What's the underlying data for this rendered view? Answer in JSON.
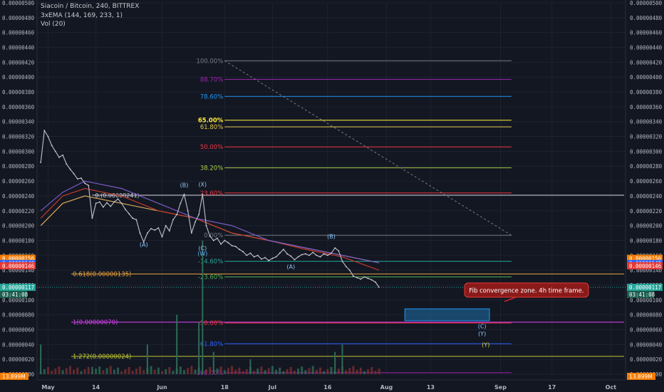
{
  "chart_data": {
    "type": "line",
    "legend": {
      "title": "Siacoin / Bitcoin, 240, BITTREX",
      "indicator_ema": "3xEMA (144, 169, 233, 1)",
      "indicator_vol": "Vol (20)"
    },
    "ylim": [
      0,
      5e-06
    ],
    "yticks": [
      "0.00000500",
      "0.00000480",
      "0.00000460",
      "0.00000440",
      "0.00000420",
      "0.00000400",
      "0.00000380",
      "0.00000360",
      "0.00000340",
      "0.00000320",
      "0.00000300",
      "0.00000280",
      "0.00000260",
      "0.00000240",
      "0.00000220",
      "0.00000200",
      "0.00000180",
      "0.00000160",
      "0.00000140",
      "0.00000120",
      "0.00000100",
      "0.00000080",
      "0.00000060",
      "0.00000040",
      "0.00000020",
      "0.00000000"
    ],
    "x_ticks": [
      {
        "label": "May",
        "x": 0
      },
      {
        "label": "14",
        "x": 13
      },
      {
        "label": "Jun",
        "x": 31
      },
      {
        "label": "18",
        "x": 48
      },
      {
        "label": "Jul",
        "x": 61
      },
      {
        "label": "16",
        "x": 76
      },
      {
        "label": "Aug",
        "x": 92
      },
      {
        "label": "13",
        "x": 104
      },
      {
        "label": "Sep",
        "x": 123
      },
      {
        "label": "17",
        "x": 137
      },
      {
        "label": "Oct",
        "x": 153
      }
    ],
    "price_series": [
      {
        "x": -2,
        "y": 2.85e-06
      },
      {
        "x": -1,
        "y": 3.28e-06
      },
      {
        "x": 0,
        "y": 3.2e-06
      },
      {
        "x": 1,
        "y": 3.08e-06
      },
      {
        "x": 2,
        "y": 3e-06
      },
      {
        "x": 3,
        "y": 2.92e-06
      },
      {
        "x": 4,
        "y": 2.95e-06
      },
      {
        "x": 5,
        "y": 2.83e-06
      },
      {
        "x": 6,
        "y": 2.76e-06
      },
      {
        "x": 7,
        "y": 2.7e-06
      },
      {
        "x": 8,
        "y": 2.63e-06
      },
      {
        "x": 9,
        "y": 2.64e-06
      },
      {
        "x": 10,
        "y": 2.57e-06
      },
      {
        "x": 11,
        "y": 2.54e-06
      },
      {
        "x": 12,
        "y": 2.1e-06
      },
      {
        "x": 13,
        "y": 2.3e-06
      },
      {
        "x": 14,
        "y": 2.32e-06
      },
      {
        "x": 15,
        "y": 2.25e-06
      },
      {
        "x": 16,
        "y": 2.31e-06
      },
      {
        "x": 17,
        "y": 2.26e-06
      },
      {
        "x": 18,
        "y": 2.32e-06
      },
      {
        "x": 19,
        "y": 2.36e-06
      },
      {
        "x": 20,
        "y": 2.3e-06
      },
      {
        "x": 21,
        "y": 2.22e-06
      },
      {
        "x": 22,
        "y": 2.16e-06
      },
      {
        "x": 23,
        "y": 2.1e-06
      },
      {
        "x": 24,
        "y": 2.08e-06
      },
      {
        "x": 25,
        "y": 1.9e-06
      },
      {
        "x": 26,
        "y": 1.78e-06
      },
      {
        "x": 27,
        "y": 1.9e-06
      },
      {
        "x": 28,
        "y": 1.96e-06
      },
      {
        "x": 29,
        "y": 1.94e-06
      },
      {
        "x": 30,
        "y": 1.97e-06
      },
      {
        "x": 31,
        "y": 1.85e-06
      },
      {
        "x": 32,
        "y": 2e-06
      },
      {
        "x": 33,
        "y": 1.93e-06
      },
      {
        "x": 34,
        "y": 2.08e-06
      },
      {
        "x": 35,
        "y": 2.15e-06
      },
      {
        "x": 36,
        "y": 2.3e-06
      },
      {
        "x": 37,
        "y": 2.42e-06
      },
      {
        "x": 38,
        "y": 2.2e-06
      },
      {
        "x": 39,
        "y": 1.9e-06
      },
      {
        "x": 40,
        "y": 2.05e-06
      },
      {
        "x": 41,
        "y": 2.15e-06
      },
      {
        "x": 42,
        "y": 2.42e-06
      },
      {
        "x": 43,
        "y": 2e-06
      },
      {
        "x": 44,
        "y": 1.86e-06
      },
      {
        "x": 45,
        "y": 1.8e-06
      },
      {
        "x": 46,
        "y": 1.83e-06
      },
      {
        "x": 47,
        "y": 1.75e-06
      },
      {
        "x": 48,
        "y": 1.8e-06
      },
      {
        "x": 49,
        "y": 1.77e-06
      },
      {
        "x": 50,
        "y": 1.73e-06
      },
      {
        "x": 51,
        "y": 1.72e-06
      },
      {
        "x": 52,
        "y": 1.68e-06
      },
      {
        "x": 53,
        "y": 1.65e-06
      },
      {
        "x": 54,
        "y": 1.6e-06
      },
      {
        "x": 55,
        "y": 1.63e-06
      },
      {
        "x": 56,
        "y": 1.58e-06
      },
      {
        "x": 57,
        "y": 1.6e-06
      },
      {
        "x": 58,
        "y": 1.55e-06
      },
      {
        "x": 59,
        "y": 1.57e-06
      },
      {
        "x": 60,
        "y": 1.53e-06
      },
      {
        "x": 61,
        "y": 1.56e-06
      },
      {
        "x": 62,
        "y": 1.58e-06
      },
      {
        "x": 63,
        "y": 1.63e-06
      },
      {
        "x": 64,
        "y": 1.68e-06
      },
      {
        "x": 65,
        "y": 1.62e-06
      },
      {
        "x": 66,
        "y": 1.59e-06
      },
      {
        "x": 67,
        "y": 1.54e-06
      },
      {
        "x": 68,
        "y": 1.58e-06
      },
      {
        "x": 69,
        "y": 1.61e-06
      },
      {
        "x": 70,
        "y": 1.62e-06
      },
      {
        "x": 71,
        "y": 1.6e-06
      },
      {
        "x": 72,
        "y": 1.64e-06
      },
      {
        "x": 73,
        "y": 1.6e-06
      },
      {
        "x": 74,
        "y": 1.58e-06
      },
      {
        "x": 75,
        "y": 1.62e-06
      },
      {
        "x": 76,
        "y": 1.6e-06
      },
      {
        "x": 77,
        "y": 1.63e-06
      },
      {
        "x": 78,
        "y": 1.7e-06
      },
      {
        "x": 79,
        "y": 1.66e-06
      },
      {
        "x": 80,
        "y": 1.52e-06
      },
      {
        "x": 81,
        "y": 1.45e-06
      },
      {
        "x": 82,
        "y": 1.4e-06
      },
      {
        "x": 83,
        "y": 1.32e-06
      },
      {
        "x": 84,
        "y": 1.3e-06
      },
      {
        "x": 85,
        "y": 1.28e-06
      },
      {
        "x": 86,
        "y": 1.31e-06
      },
      {
        "x": 87,
        "y": 1.29e-06
      },
      {
        "x": 88,
        "y": 1.27e-06
      },
      {
        "x": 89,
        "y": 1.24e-06
      },
      {
        "x": 90,
        "y": 1.17e-06
      }
    ],
    "volume_spikes": [
      {
        "x": -2,
        "v": 4e-07
      },
      {
        "x": 12,
        "v": 1e-07
      },
      {
        "x": 27,
        "v": 4e-07
      },
      {
        "x": 35,
        "v": 8e-07
      },
      {
        "x": 41,
        "v": 7e-07
      },
      {
        "x": 42,
        "v": 1.8e-06
      },
      {
        "x": 45,
        "v": 3e-07
      },
      {
        "x": 55,
        "v": 2e-07
      },
      {
        "x": 78,
        "v": 3e-07
      },
      {
        "x": 80,
        "v": 4e-07
      }
    ],
    "ema_series": [
      {
        "name": "EMA 144",
        "color": "#d7a85a",
        "points": [
          {
            "x": -2,
            "y": 2e-06
          },
          {
            "x": 4,
            "y": 2.3e-06
          },
          {
            "x": 10,
            "y": 2.4e-06
          },
          {
            "x": 20,
            "y": 2.3e-06
          },
          {
            "x": 30,
            "y": 2.2e-06
          },
          {
            "x": 40,
            "y": 2.1e-06
          },
          {
            "x": 50,
            "y": 1.9e-06
          },
          {
            "x": 60,
            "y": 1.8e-06
          },
          {
            "x": 70,
            "y": 1.7e-06
          },
          {
            "x": 80,
            "y": 1.6e-06
          },
          {
            "x": 90,
            "y": 1.5e-06
          }
        ]
      },
      {
        "name": "EMA 169",
        "color": "#c0392b",
        "points": [
          {
            "x": -2,
            "y": 2.1e-06
          },
          {
            "x": 4,
            "y": 2.4e-06
          },
          {
            "x": 10,
            "y": 2.5e-06
          },
          {
            "x": 20,
            "y": 2.4e-06
          },
          {
            "x": 30,
            "y": 2.2e-06
          },
          {
            "x": 40,
            "y": 2.1e-06
          },
          {
            "x": 50,
            "y": 1.9e-06
          },
          {
            "x": 60,
            "y": 1.8e-06
          },
          {
            "x": 70,
            "y": 1.68e-06
          },
          {
            "x": 80,
            "y": 1.58e-06
          },
          {
            "x": 90,
            "y": 1.4e-06
          }
        ]
      },
      {
        "name": "EMA 233",
        "color": "#7b5cc4",
        "points": [
          {
            "x": -2,
            "y": 2.2e-06
          },
          {
            "x": 4,
            "y": 2.45e-06
          },
          {
            "x": 10,
            "y": 2.6e-06
          },
          {
            "x": 20,
            "y": 2.5e-06
          },
          {
            "x": 30,
            "y": 2.3e-06
          },
          {
            "x": 40,
            "y": 2.1e-06
          },
          {
            "x": 50,
            "y": 2e-06
          },
          {
            "x": 60,
            "y": 1.8e-06
          },
          {
            "x": 70,
            "y": 1.7e-06
          },
          {
            "x": 80,
            "y": 1.6e-06
          },
          {
            "x": 90,
            "y": 1.5e-06
          }
        ]
      }
    ],
    "fib_retracement": [
      {
        "label": "100.00%",
        "price": 4.22e-06,
        "color": "#787b86"
      },
      {
        "label": "88.70%",
        "price": 3.97e-06,
        "color": "#9c27b0"
      },
      {
        "label": "78.60%",
        "price": 3.74e-06,
        "color": "#2196f3"
      },
      {
        "label": "65.00%",
        "price": 3.42e-06,
        "color": "#ffeb3b",
        "bold": true
      },
      {
        "label": "61.80%",
        "price": 3.33e-06,
        "color": "#e0c94a"
      },
      {
        "label": "50.00%",
        "price": 3.06e-06,
        "color": "#f23645"
      },
      {
        "label": "38.20%",
        "price": 2.78e-06,
        "color": "#a8cc4a"
      },
      {
        "label": "23.60%",
        "price": 2.44e-06,
        "color": "#f23645"
      },
      {
        "label": "0.00%",
        "price": 1.87e-06,
        "color": "#787b86"
      },
      {
        "label": "-14.60%",
        "price": 1.52e-06,
        "color": "#26a69a"
      },
      {
        "label": "-23.60%",
        "price": 1.31e-06,
        "color": "#4caf50"
      },
      {
        "label": "-50.00%",
        "price": 6.9e-07,
        "color": "#f23645"
      },
      {
        "label": "-61.80%",
        "price": 4.1e-07,
        "color": "#2962ff"
      },
      {
        "label": "-100.00%",
        "price": 2e-08,
        "color": "#9c27b0"
      }
    ],
    "fib_extension": [
      {
        "label": "0.618(0.00000135)",
        "price": 1.35e-06,
        "color": "#e6a23c"
      },
      {
        "label": "1(0.00000070)",
        "price": 7e-07,
        "color": "#e040fb"
      },
      {
        "label": "1.272(0.00000024)",
        "price": 2.4e-07,
        "color": "#c0ca33"
      }
    ],
    "hline_label": "0.(0.00000241)",
    "hline_price": 2.41e-06,
    "wave_labels": [
      {
        "text": "(A)",
        "x": 26,
        "y": 1.72e-06,
        "color": "#90caf9"
      },
      {
        "text": "(B)",
        "x": 37,
        "y": 2.52e-06,
        "color": "#90caf9"
      },
      {
        "text": "(X)",
        "x": 42,
        "y": 2.53e-06,
        "color": "#90caf9"
      },
      {
        "text": "(C)",
        "x": 42,
        "y": 1.67e-06,
        "color": "#90caf9"
      },
      {
        "text": "(W)",
        "x": 42,
        "y": 1.6e-06,
        "color": "#64b5f6"
      },
      {
        "text": "(A)",
        "x": 66,
        "y": 1.42e-06,
        "color": "#90caf9"
      },
      {
        "text": "(B)",
        "x": 77,
        "y": 1.83e-06,
        "color": "#90caf9"
      },
      {
        "text": "(C)",
        "x": 118,
        "y": 6.2e-07,
        "color": "#90caf9"
      },
      {
        "text": "(Y)",
        "x": 118,
        "y": 5.2e-07,
        "color": "#90caf9"
      },
      {
        "text": "(Y)",
        "x": 119,
        "y": 3.7e-07,
        "color": "#e6d749"
      }
    ],
    "annotation": "Fib convergence zone. 4h time frame.",
    "current_time": "03:41:08",
    "price_badges": [
      {
        "text": "0.00000156",
        "price": 1.56e-06,
        "color": "#f57c00"
      },
      {
        "text": "0.00000149",
        "price": 1.49e-06,
        "color": "#2962ff"
      },
      {
        "text": "0.00000146",
        "price": 1.46e-06,
        "color": "#e53935"
      },
      {
        "text": "0.00000117",
        "price": 1.17e-06,
        "color": "#26a69a"
      }
    ],
    "volume_badge": "13.899M"
  }
}
